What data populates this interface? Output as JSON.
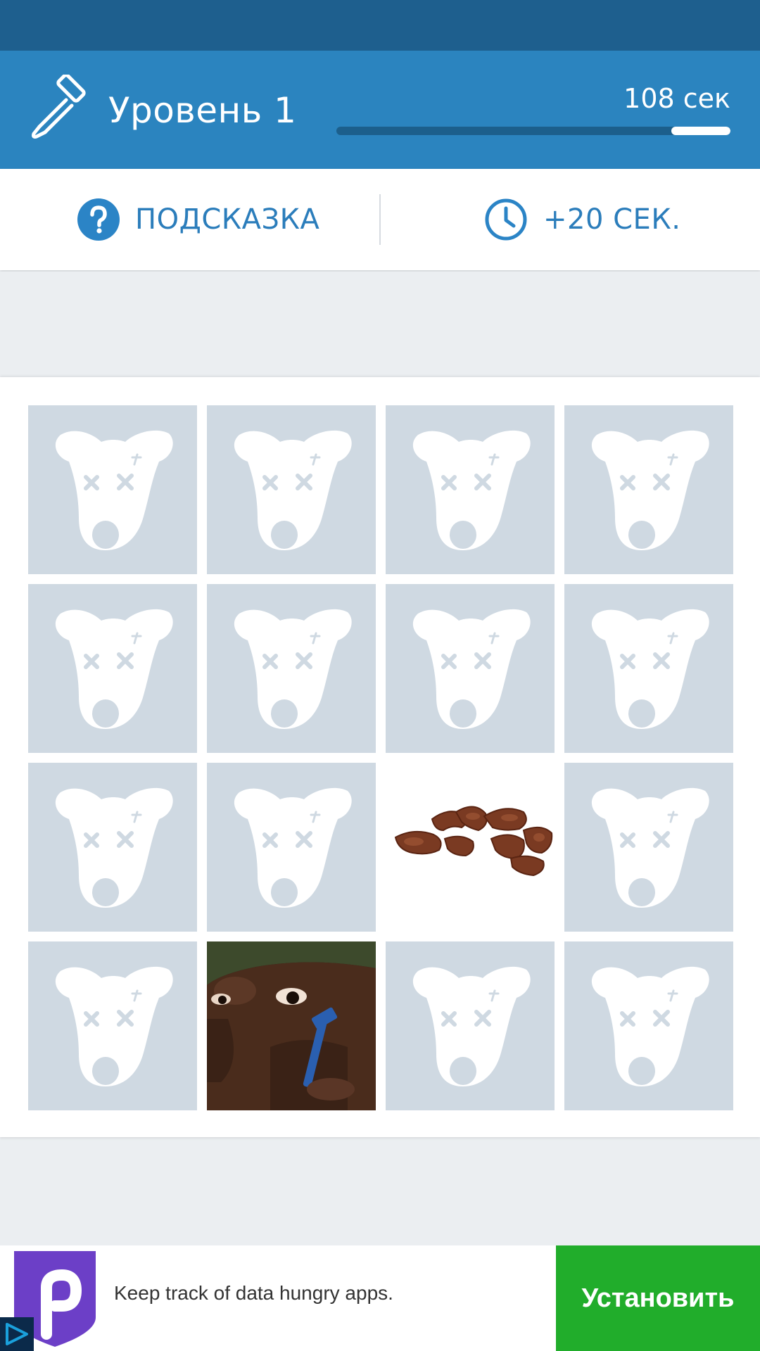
{
  "header": {
    "level_title": "Уровень 1",
    "timer_text": "108 сек",
    "time_remaining_fraction": 0.15
  },
  "actions": {
    "hint_label": "ПОДСКАЗКА",
    "hint_icon": "question-circle-icon",
    "time_label": "+20 СЕК.",
    "time_icon": "clock-icon"
  },
  "board": {
    "rows": 4,
    "cols": 4,
    "tiles": [
      {
        "state": "hidden"
      },
      {
        "state": "hidden"
      },
      {
        "state": "hidden"
      },
      {
        "state": "hidden"
      },
      {
        "state": "hidden"
      },
      {
        "state": "hidden"
      },
      {
        "state": "hidden"
      },
      {
        "state": "hidden"
      },
      {
        "state": "hidden"
      },
      {
        "state": "hidden"
      },
      {
        "state": "revealed",
        "image": "chocolate-curls"
      },
      {
        "state": "hidden"
      },
      {
        "state": "hidden"
      },
      {
        "state": "revealed",
        "image": "man-shaving"
      },
      {
        "state": "hidden"
      },
      {
        "state": "hidden"
      }
    ],
    "hidden_icon": "dead-dog-placeholder-icon"
  },
  "ad": {
    "text": "Keep track of data hungry apps.",
    "install_label": "Установить",
    "logo_icon": "p-shield-logo-icon"
  },
  "colors": {
    "status_bar": "#1e5f8e",
    "header": "#2b84bf",
    "accent": "#2b7dbb",
    "tile_hidden": "#cfd9e2",
    "install_button": "#21ad2b"
  }
}
